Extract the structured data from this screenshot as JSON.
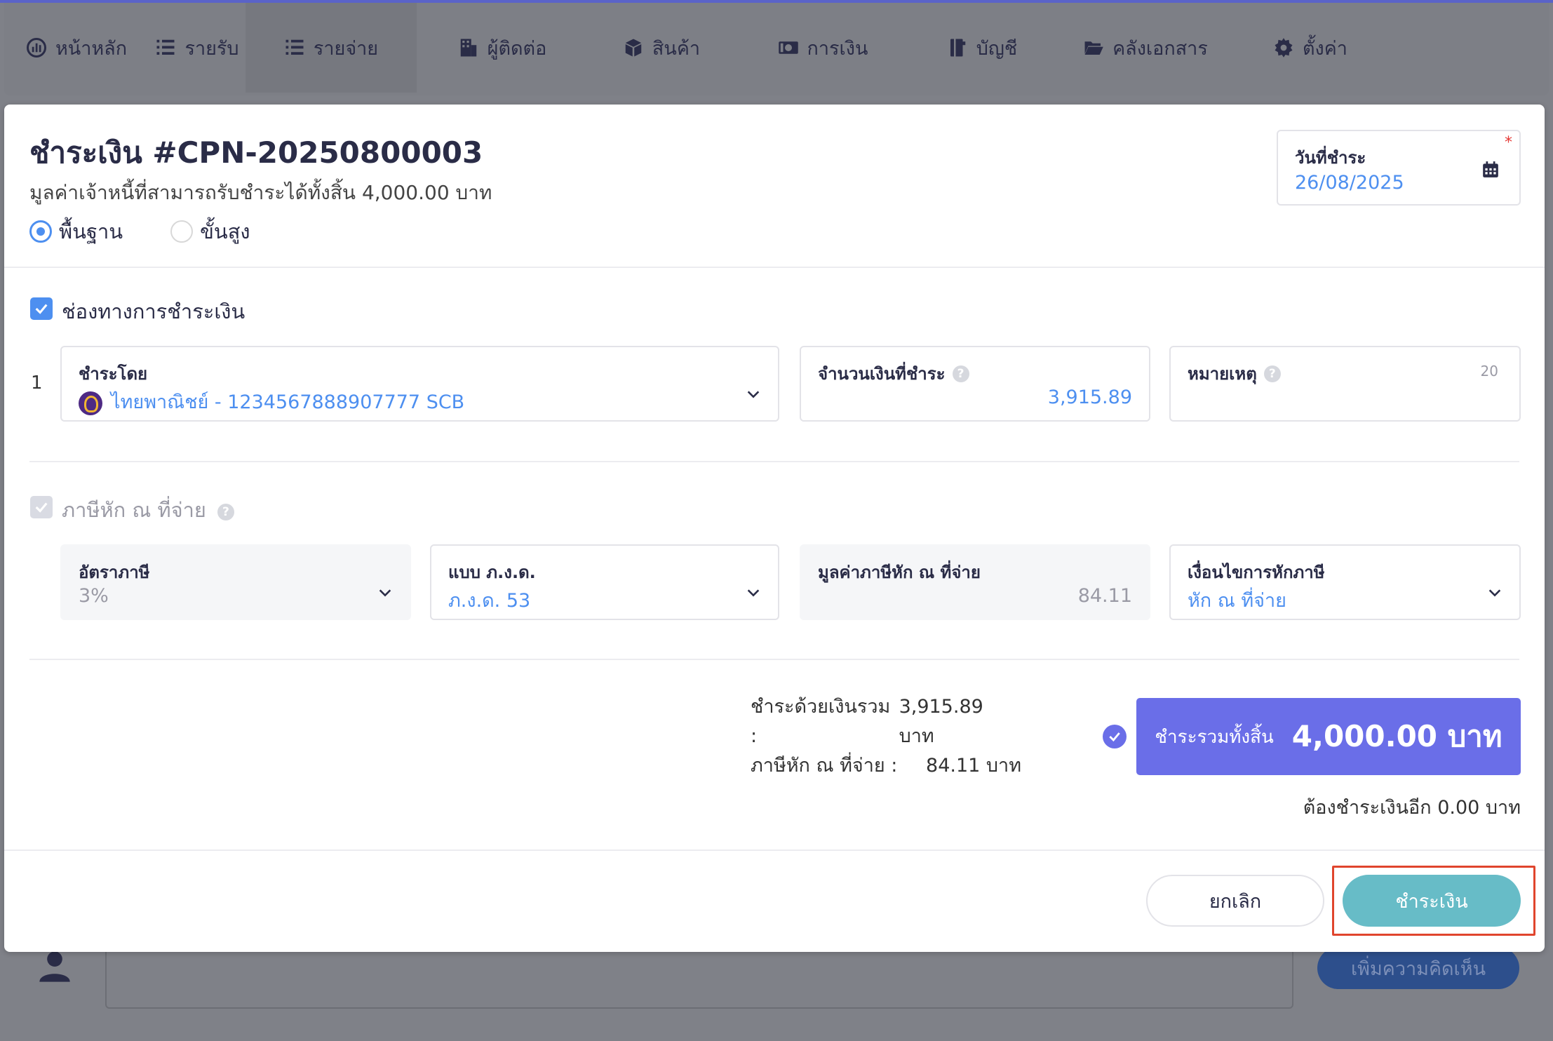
{
  "nav": {
    "items": [
      {
        "label": "หน้าหลัก",
        "icon": "dashboard-icon"
      },
      {
        "label": "รายรับ",
        "icon": "income-icon"
      },
      {
        "label": "รายจ่าย",
        "icon": "expense-icon"
      },
      {
        "label": "ผู้ติดต่อ",
        "icon": "contacts-icon"
      },
      {
        "label": "สินค้า",
        "icon": "box-icon"
      },
      {
        "label": "การเงิน",
        "icon": "money-icon"
      },
      {
        "label": "บัญชี",
        "icon": "ledger-icon"
      },
      {
        "label": "คลังเอกสาร",
        "icon": "folder-icon"
      },
      {
        "label": "ตั้งค่า",
        "icon": "gear-icon"
      }
    ],
    "active": "รายจ่าย"
  },
  "modal": {
    "title": "ชำระเงิน #CPN-20250800003",
    "subtitle": "มูลค่าเจ้าหนี้ที่สามารถรับชำระได้ทั้งสิ้น 4,000.00 บาท",
    "mode_options": {
      "basic": "พื้นฐาน",
      "advanced": "ขั้นสูง"
    },
    "selected_mode": "พื้นฐาน",
    "payment_date": {
      "label": "วันที่ชำระ",
      "value": "26/08/2025",
      "required_mark": "*"
    },
    "payment_channel": {
      "label": "ช่องทางการชำระเงิน",
      "row_number": "1",
      "paid_by": {
        "label": "ชำระโดย",
        "value": "ไทยพาณิชย์ - 1234567888907777 SCB"
      },
      "amount": {
        "label": "จำนวนเงินที่ชำระ",
        "value": "3,915.89"
      },
      "note": {
        "label": "หมายเหตุ",
        "counter": "20"
      }
    },
    "withholding": {
      "label": "ภาษีหัก ณ ที่จ่าย",
      "tax_rate": {
        "label": "อัตราภาษี",
        "value": "3%"
      },
      "form_type": {
        "label": "แบบ ภ.ง.ด.",
        "value": "ภ.ง.ด. 53"
      },
      "tax_amount": {
        "label": "มูลค่าภาษีหัก ณ ที่จ่าย",
        "value": "84.11"
      },
      "condition": {
        "label": "เงื่อนไขการหักภาษี",
        "value": "หัก ณ ที่จ่าย"
      }
    },
    "summary": {
      "cash_label": "ชำระด้วยเงินรวม :",
      "cash_value": "3,915.89 บาท",
      "wht_label": "ภาษีหัก ณ ที่จ่าย :",
      "wht_value": "84.11 บาท",
      "total_label": "ชำระรวมทั้งสิ้น",
      "total_value": "4,000.00 บาท",
      "remaining": "ต้องชำระเงินอีก 0.00 บาท"
    },
    "buttons": {
      "cancel": "ยกเลิก",
      "pay": "ชำระเงิน"
    }
  },
  "background": {
    "comment_button": "เพิ่มความคิดเห็น"
  },
  "colors": {
    "accent": "#4d8ff0",
    "total_bg": "#6a6ee8",
    "pay_button": "#67bcc7",
    "highlight": "#e0452d",
    "nav_text": "#2a2c47"
  }
}
